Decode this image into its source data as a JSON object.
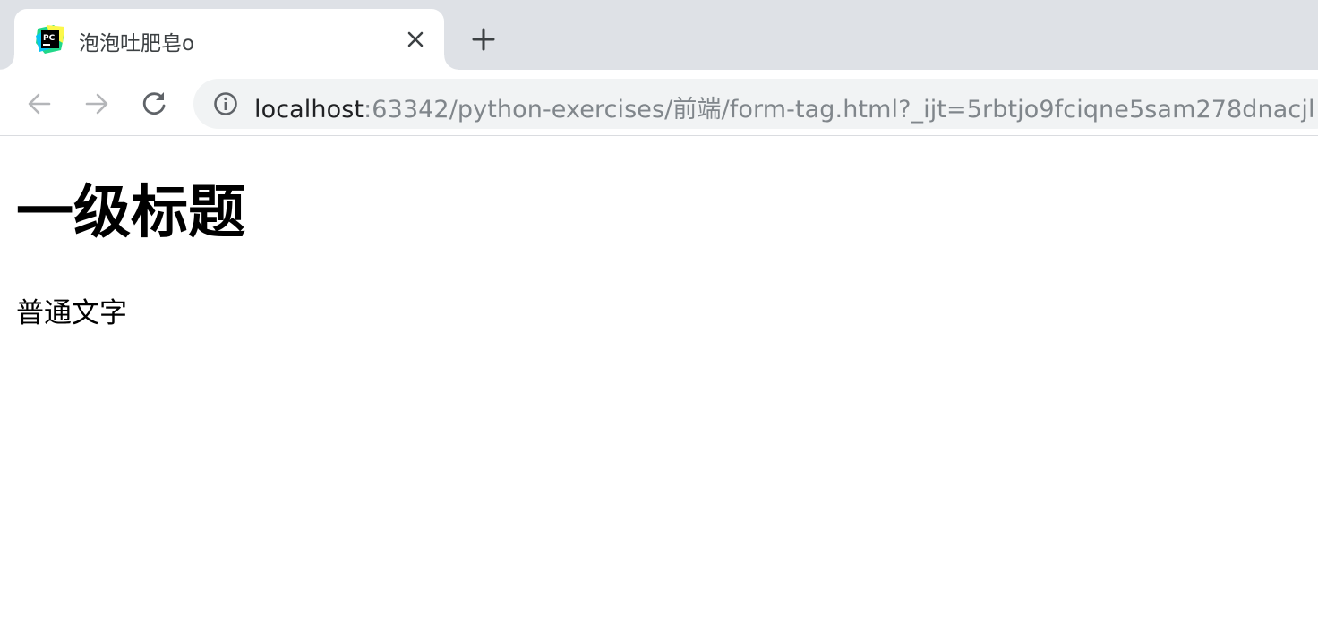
{
  "browser": {
    "tab": {
      "title": "泡泡吐肥皂o",
      "favicon_text": "PC",
      "close_icon": "close-icon"
    },
    "new_tab_icon": "plus-icon",
    "toolbar": {
      "back_icon": "arrow-left-icon",
      "forward_icon": "arrow-right-icon",
      "reload_icon": "reload-icon",
      "site_info_icon": "info-icon"
    },
    "address": {
      "host": "localhost",
      "rest": ":63342/python-exercises/前端/form-tag.html?_ijt=5rbtjo9fciqne5sam278dnacjl"
    },
    "colors": {
      "tabstrip": "#dee1e6",
      "omnibox": "#f1f3f4",
      "url_secondary": "#80868b"
    }
  },
  "page": {
    "heading": "一级标题",
    "paragraph": "普通文字"
  }
}
